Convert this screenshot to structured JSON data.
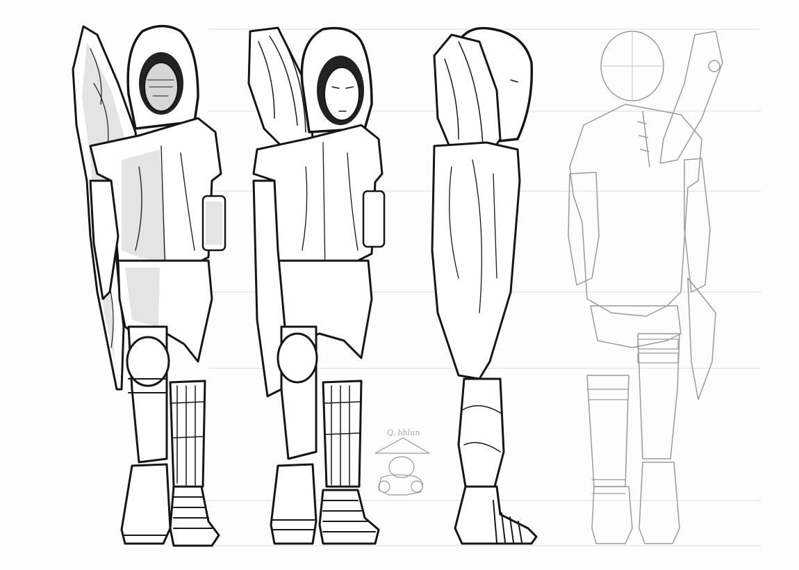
{
  "sheet": {
    "handwritten_note": "Q. bhlun",
    "views": [
      {
        "name": "front-shaded",
        "style": "inked-shaded"
      },
      {
        "name": "front-lineart",
        "style": "inked"
      },
      {
        "name": "side-lineart",
        "style": "inked"
      },
      {
        "name": "back-sketch",
        "style": "pencil"
      }
    ],
    "colors": {
      "ink": "#151515",
      "pencil": "#9a9a9a",
      "paper": "#fdfdfd",
      "guide": "#dcdcdc"
    }
  }
}
